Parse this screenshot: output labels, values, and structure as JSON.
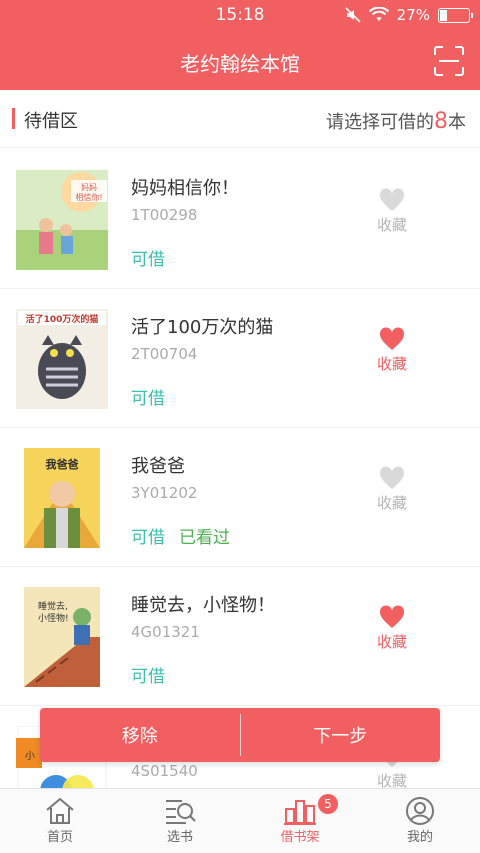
{
  "status": {
    "time": "15:18",
    "battery": "27%",
    "battery_level": 0.27
  },
  "header": {
    "title": "老约翰绘本馆",
    "scan_icon": "scan-icon"
  },
  "section": {
    "label": "待借区",
    "hint_prefix": "请选择可借的",
    "hint_count": "8",
    "hint_suffix": "本"
  },
  "books": [
    {
      "name": "妈妈相信你！",
      "code": "1T00298",
      "status": "可借",
      "seen": "",
      "fav_label": "收藏",
      "favorited": false,
      "cover_text": "妈妈相信你!"
    },
    {
      "name": "活了100万次的猫",
      "code": "2T00704",
      "status": "可借",
      "seen": "",
      "fav_label": "收藏",
      "favorited": true,
      "cover_text": "活了100万次的猫"
    },
    {
      "name": "我爸爸",
      "code": "3Y01202",
      "status": "可借",
      "seen": "已看过",
      "fav_label": "收藏",
      "favorited": false,
      "cover_text": "我爸爸"
    },
    {
      "name": "睡觉去，小怪物！",
      "code": "4G01321",
      "status": "可借",
      "seen": "",
      "fav_label": "收藏",
      "favorited": true,
      "cover_text": "睡觉去,小怪物!"
    },
    {
      "name": "",
      "code": "4S01540",
      "status": "",
      "seen": "",
      "fav_label": "收藏",
      "favorited": false,
      "cover_text": "小"
    }
  ],
  "actions": {
    "remove": "移除",
    "next": "下一步"
  },
  "tabs": [
    {
      "label": "首页",
      "icon": "home-icon"
    },
    {
      "label": "选书",
      "icon": "search-list-icon"
    },
    {
      "label": "借书架",
      "icon": "bookshelf-icon",
      "badge": "5"
    },
    {
      "label": "我的",
      "icon": "profile-icon"
    }
  ],
  "colors": {
    "brand": "#f25f61",
    "available": "#3cbfae",
    "seen": "#4caf50"
  }
}
